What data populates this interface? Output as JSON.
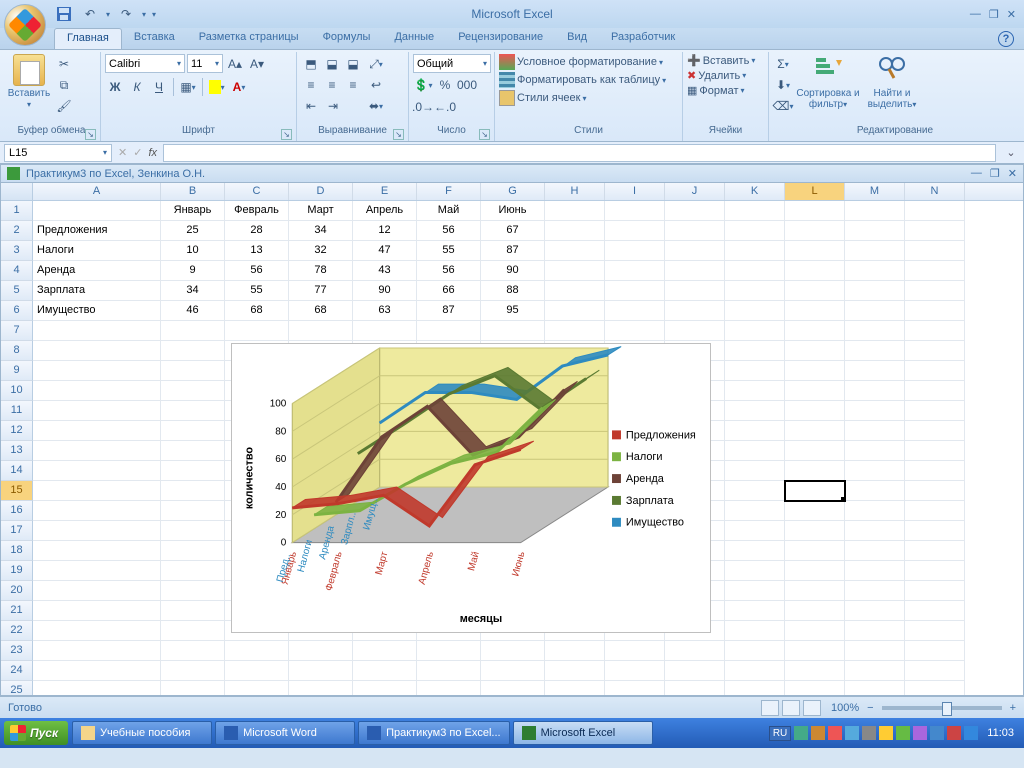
{
  "app_title": "Microsoft Excel",
  "qat": {
    "save": "save-icon",
    "undo": "↶",
    "redo": "↷"
  },
  "tabs": [
    "Главная",
    "Вставка",
    "Разметка страницы",
    "Формулы",
    "Данные",
    "Рецензирование",
    "Вид",
    "Разработчик"
  ],
  "active_tab": 0,
  "ribbon": {
    "clipboard": {
      "paste": "Вставить",
      "label": "Буфер обмена"
    },
    "font": {
      "name": "Calibri",
      "size": "11",
      "label": "Шрифт",
      "bold": "Ж",
      "italic": "К",
      "underline": "Ч"
    },
    "align": {
      "label": "Выравнивание"
    },
    "number": {
      "format": "Общий",
      "label": "Число"
    },
    "styles": {
      "cond": "Условное форматирование",
      "table": "Форматировать как таблицу",
      "cell": "Стили ячеек",
      "label": "Стили"
    },
    "cells": {
      "insert": "Вставить",
      "delete": "Удалить",
      "format": "Формат",
      "label": "Ячейки"
    },
    "edit": {
      "sort": "Сортировка и фильтр",
      "find": "Найти и выделить",
      "label": "Редактирование"
    }
  },
  "namebox": "L15",
  "workbook_title": "Практикум3 по Excel, Зенкина О.Н.",
  "columns": [
    "A",
    "B",
    "C",
    "D",
    "E",
    "F",
    "G",
    "H",
    "I",
    "J",
    "K",
    "L",
    "M",
    "N"
  ],
  "months": [
    "Январь",
    "Февраль",
    "Март",
    "Апрель",
    "Май",
    "Июнь"
  ],
  "rows": [
    {
      "label": "Предложения",
      "vals": [
        25,
        28,
        34,
        12,
        56,
        67
      ]
    },
    {
      "label": "Налоги",
      "vals": [
        10,
        13,
        32,
        47,
        55,
        87
      ]
    },
    {
      "label": "Аренда",
      "vals": [
        9,
        56,
        78,
        43,
        56,
        90
      ]
    },
    {
      "label": "Зарплата",
      "vals": [
        34,
        55,
        77,
        90,
        66,
        88
      ]
    },
    {
      "label": "Имущество",
      "vals": [
        46,
        68,
        68,
        63,
        87,
        95
      ]
    }
  ],
  "active_cell": "L15",
  "status": {
    "ready": "Готово",
    "zoom": "100%"
  },
  "taskbar": {
    "start": "Пуск",
    "items": [
      {
        "label": "Учебные пособия",
        "icon": "folder"
      },
      {
        "label": "Microsoft Word",
        "icon": "word"
      },
      {
        "label": "Практикум3 по Excel...",
        "icon": "word"
      },
      {
        "label": "Microsoft Excel",
        "icon": "excel",
        "active": true
      }
    ],
    "lang": "RU",
    "clock": "11:03"
  },
  "chart_data": {
    "type": "line3d",
    "title": "",
    "xlabel": "месяцы",
    "ylabel": "количество",
    "ylim": [
      0,
      100
    ],
    "yticks": [
      0,
      20,
      40,
      60,
      80,
      100
    ],
    "categories": [
      "Январь",
      "Февраль",
      "Март",
      "Апрель",
      "Май",
      "Июнь"
    ],
    "depth_categories": [
      "Имущ..",
      "Зарпл..",
      "Аренда",
      "Налоги",
      "Пред.."
    ],
    "series": [
      {
        "name": "Предложения",
        "color": "#c0392b",
        "values": [
          25,
          28,
          34,
          12,
          56,
          67
        ]
      },
      {
        "name": "Налоги",
        "color": "#7cb342",
        "values": [
          10,
          13,
          32,
          47,
          55,
          87
        ]
      },
      {
        "name": "Аренда",
        "color": "#6d4237",
        "values": [
          9,
          56,
          78,
          43,
          56,
          90
        ]
      },
      {
        "name": "Зарплата",
        "color": "#5a7a32",
        "values": [
          34,
          55,
          77,
          90,
          66,
          88
        ]
      },
      {
        "name": "Имущество",
        "color": "#2e8bc0",
        "values": [
          46,
          68,
          68,
          63,
          87,
          95
        ]
      }
    ]
  }
}
